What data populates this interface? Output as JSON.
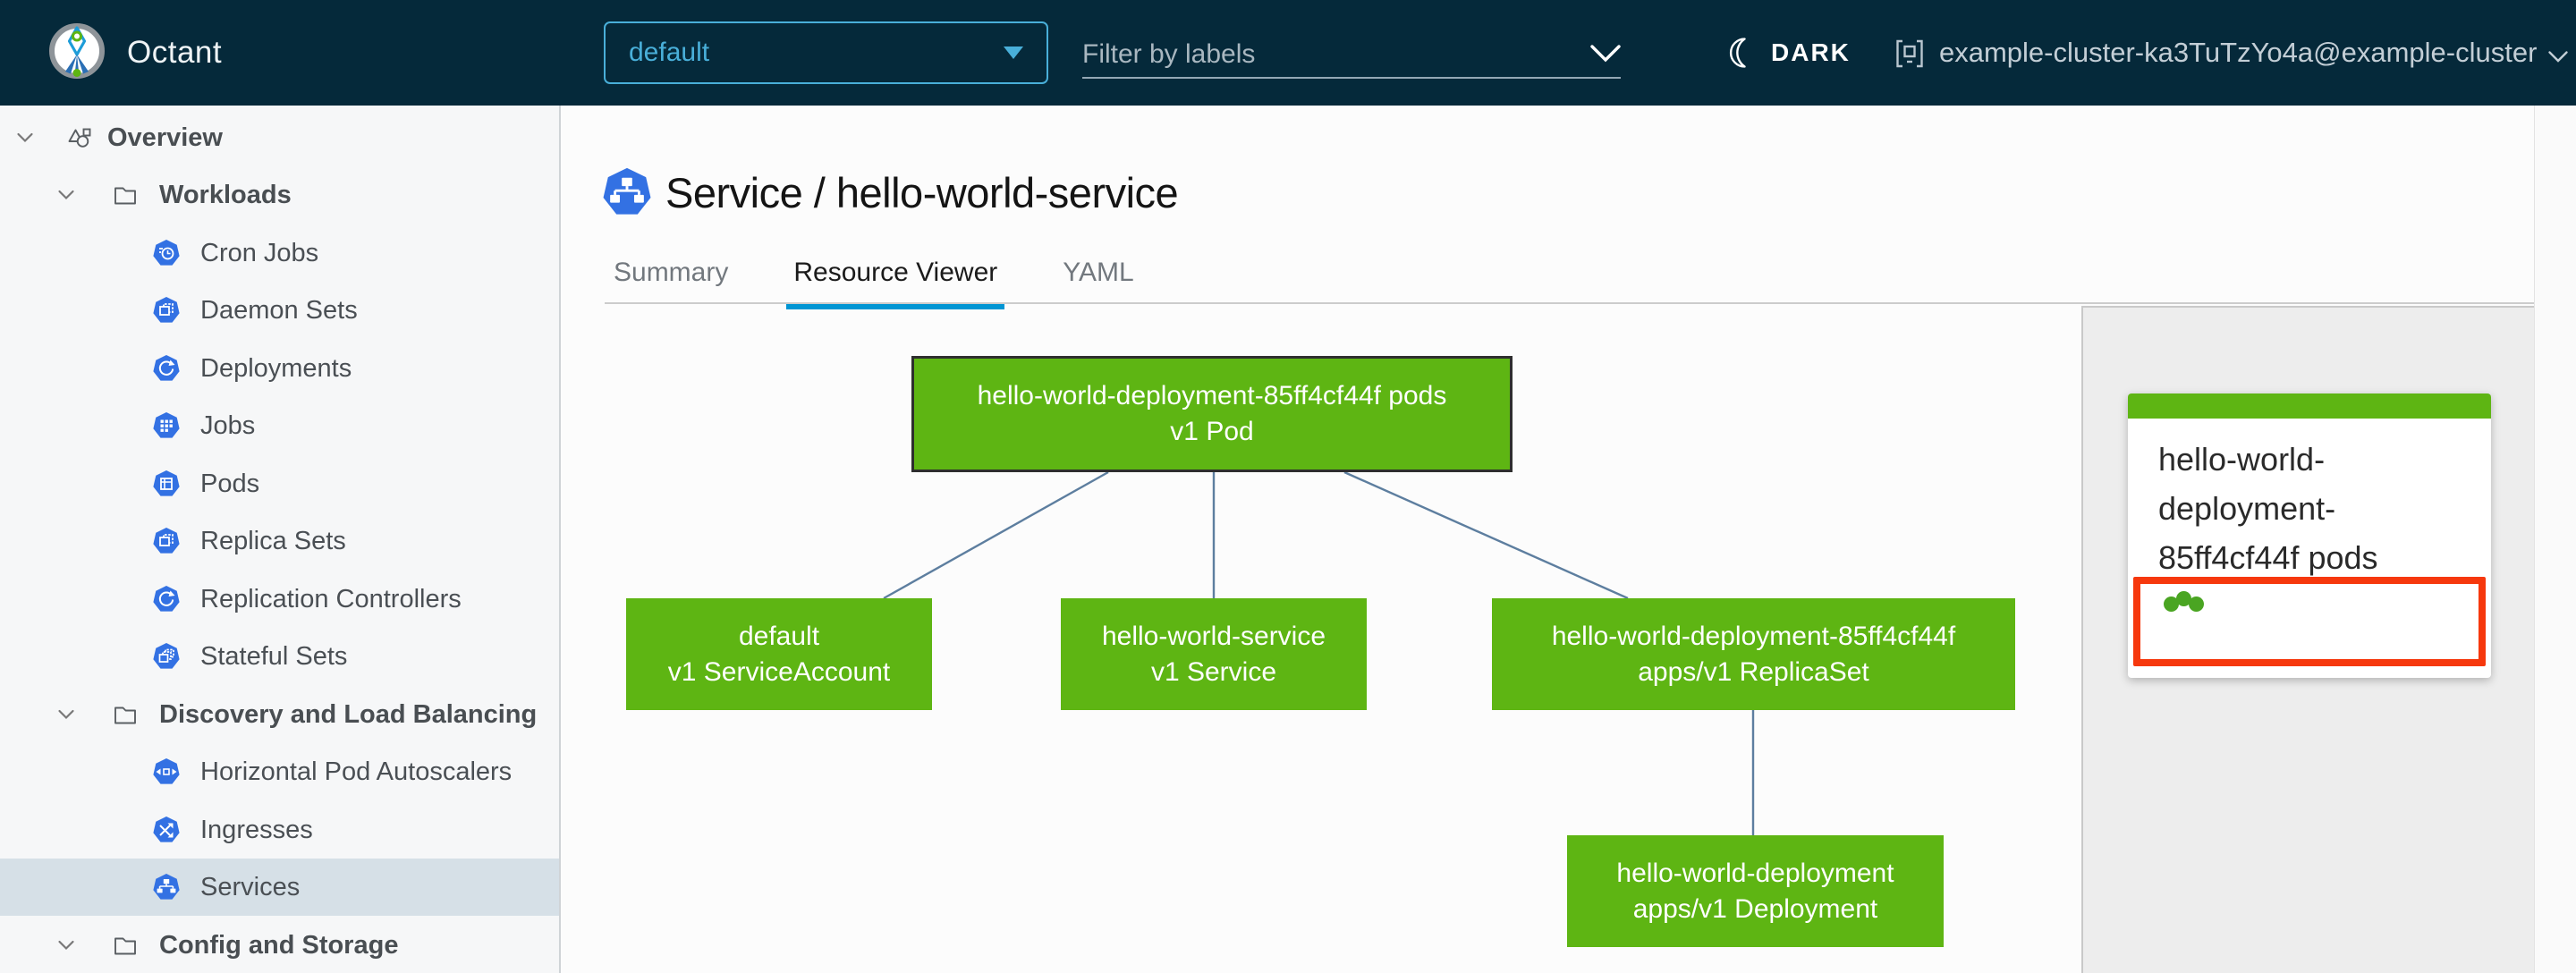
{
  "header": {
    "app_name": "Octant",
    "namespace_dropdown": {
      "value": "default"
    },
    "label_filter": {
      "placeholder": "Filter by labels"
    },
    "theme_toggle": {
      "label": "DARK"
    },
    "context_selector": {
      "label": "example-cluster-ka3TuTzYo4a@example-cluster"
    }
  },
  "sidebar": {
    "items": [
      {
        "label": "Overview"
      },
      {
        "label": "Workloads"
      },
      {
        "label": "Cron Jobs"
      },
      {
        "label": "Daemon Sets"
      },
      {
        "label": "Deployments"
      },
      {
        "label": "Jobs"
      },
      {
        "label": "Pods"
      },
      {
        "label": "Replica Sets"
      },
      {
        "label": "Replication Controllers"
      },
      {
        "label": "Stateful Sets"
      },
      {
        "label": "Discovery and Load Balancing"
      },
      {
        "label": "Horizontal Pod Autoscalers"
      },
      {
        "label": "Ingresses"
      },
      {
        "label": "Services",
        "selected": true
      },
      {
        "label": "Config and Storage"
      }
    ]
  },
  "main": {
    "title": "Service / hello-world-service",
    "tabs": [
      {
        "label": "Summary",
        "active": false
      },
      {
        "label": "Resource Viewer",
        "active": true
      },
      {
        "label": "YAML",
        "active": false
      }
    ]
  },
  "graph": {
    "nodes": [
      {
        "id": "pod",
        "name": "hello-world-deployment-85ff4cf44f pods",
        "kind": "v1 Pod",
        "selected": true
      },
      {
        "id": "serviceaccount",
        "name": "default",
        "kind": "v1 ServiceAccount",
        "selected": false
      },
      {
        "id": "service",
        "name": "hello-world-service",
        "kind": "v1 Service",
        "selected": false
      },
      {
        "id": "replicaset",
        "name": "hello-world-deployment-85ff4cf44f",
        "kind": "apps/v1 ReplicaSet",
        "selected": false
      },
      {
        "id": "deployment",
        "name": "hello-world-deployment",
        "kind": "apps/v1 Deployment",
        "selected": false
      }
    ],
    "edges": [
      [
        "pod",
        "serviceaccount"
      ],
      [
        "pod",
        "service"
      ],
      [
        "pod",
        "replicaset"
      ],
      [
        "replicaset",
        "deployment"
      ]
    ]
  },
  "detail_panel": {
    "title": "hello-world-deployment-85ff4cf44f pods",
    "pod_status_dots": 3
  },
  "colors": {
    "header_bg": "#05293a",
    "accent_blue": "#49afd9",
    "node_green": "#5eb513",
    "alert_red": "#f6380d",
    "edge_blue": "#5d7e9f",
    "k8s_icon_blue": "#3371e3",
    "tab_active_underline": "#0095d3",
    "selected_row_bg": "#d6e0e7",
    "status_dot_green": "#4aa522"
  }
}
